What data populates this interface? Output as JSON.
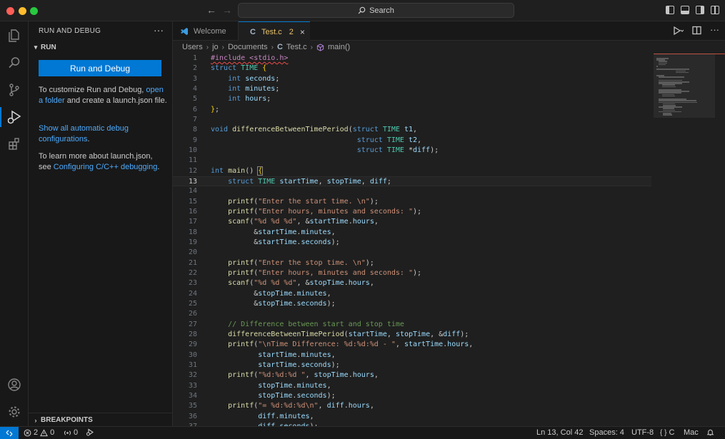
{
  "titlebar": {
    "search_label": "Search"
  },
  "sidebar": {
    "title": "RUN AND DEBUG",
    "more": "···",
    "run_section": "RUN",
    "run_button": "Run and Debug",
    "p1_a": "To customize Run and Debug, ",
    "p1_link": "open a folder",
    "p1_b": " and create a launch.json file.",
    "p2_link": "Show all automatic debug configurations",
    "p2_b": ".",
    "p3_a": "To learn more about launch.json, see ",
    "p3_link": "Configuring C/C++ debugging",
    "p3_b": ".",
    "breakpoints_section": "BREAKPOINTS"
  },
  "tabs": {
    "welcome": "Welcome",
    "active_icon": "C",
    "active": "Test.c",
    "active_badge": "2",
    "close": "×"
  },
  "breadcrumb": [
    "Users",
    "jo",
    "Documents",
    "Test.c",
    "main()"
  ],
  "breadcrumb_c": "C",
  "code_lines": [
    "#include <stdio.h>",
    "struct TIME {",
    "    int seconds;",
    "    int minutes;",
    "    int hours;",
    "};",
    "",
    "void differenceBetweenTimePeriod(struct TIME t1,",
    "                                  struct TIME t2,",
    "                                  struct TIME *diff);",
    "",
    "int main() {",
    "    struct TIME startTime, stopTime, diff;",
    "",
    "    printf(\"Enter the start time. \\n\");",
    "    printf(\"Enter hours, minutes and seconds: \");",
    "    scanf(\"%d %d %d\", &startTime.hours,",
    "          &startTime.minutes,",
    "          &startTime.seconds);",
    "",
    "    printf(\"Enter the stop time. \\n\");",
    "    printf(\"Enter hours, minutes and seconds: \");",
    "    scanf(\"%d %d %d\", &stopTime.hours,",
    "          &stopTime.minutes,",
    "          &stopTime.seconds);",
    "",
    "    // Difference between start and stop time",
    "    differenceBetweenTimePeriod(startTime, stopTime, &diff);",
    "    printf(\"\\nTime Difference: %d:%d:%d - \", startTime.hours,",
    "           startTime.minutes,",
    "           startTime.seconds);",
    "    printf(\"%d:%d:%d \", stopTime.hours,",
    "           stopTime.minutes,",
    "           stopTime.seconds);",
    "    printf(\"= %d:%d:%d\\n\", diff.hours,",
    "           diff.minutes,",
    "           diff.seconds);"
  ],
  "current_line": 13,
  "statusbar": {
    "errors": "2",
    "warnings": "0",
    "ports": "0",
    "position": "Ln 13, Col 42",
    "spaces": "Spaces: 4",
    "encoding": "UTF-8",
    "language": "C",
    "platform": "Mac"
  },
  "colors": {
    "accent": "#0078d4",
    "link": "#4daafc",
    "modified_tab": "#e8c26d",
    "error": "#f14c4c"
  }
}
